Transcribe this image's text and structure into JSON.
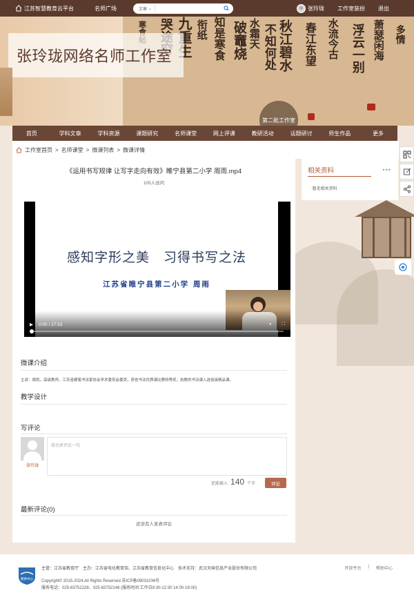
{
  "topbar": {
    "platform": "江苏智慧教育云平台",
    "teacher_square": "名师广场",
    "search_scope": "文章",
    "search_placeholder": "",
    "user_name": "张玲珑",
    "decorate": "工作室装扮",
    "logout": "退出"
  },
  "banner": {
    "title": "张玲珑网络名师工作室",
    "badge": "第二批工作室"
  },
  "nav": [
    "首页",
    "学科文章",
    "学科资源",
    "课题研究",
    "名师课堂",
    "网上评课",
    "教研活动",
    "话题研讨",
    "师生作品",
    "更多"
  ],
  "breadcrumb": [
    "工作室首页",
    "名师课堂",
    "微课列表",
    "微课详情"
  ],
  "breadcrumb_sep": ">",
  "video": {
    "title": "《运用书写规律 让写字走向有效》睢宁县第二小学 周雨.mp4",
    "visits": "105人访问",
    "slide_heading": "感知字形之美　习得书写之法",
    "slide_sub": "江苏省睢宁县第二小学 周雨",
    "time": "0:00 / 27:53",
    "progress": 0.0
  },
  "sections": {
    "intro_title": "微课介绍",
    "intro_text": "主讲：周雨，高级教师，江苏省硬笔书法家协会学术委员会委员，获省书法优质课比赛特等奖，执教的书法课入选省级精品课。",
    "design_title": "教学设计",
    "comment_title": "写评论",
    "comment_placeholder": "我也来评论一句",
    "commenter": "张玲珑",
    "can_input_label": "还能输入",
    "char_count": "140",
    "char_unit": "个字",
    "comment_button": "评论",
    "latest_title": "最新评论(0)",
    "no_comment": "还没有人发表评论"
  },
  "sidebar": {
    "title": "相关资料",
    "more": "•••",
    "empty": "暂无相关资料"
  },
  "footer": {
    "line1": "主管：江苏省教育厅　主办：江苏省电化教育馆、江苏省教育信息化中心　技术支持：武汉天喻信息产业股份有限公司",
    "line2": "Copyright© 2015-2024,All Rights Reserved 苏ICP备09031036号",
    "line3": "服务电话：025-83752228、025-83752146 (服务时间:工作日8:30-12:30 14:00-18:00)",
    "link_open": "开放平台",
    "link_sep": "|",
    "link_help": "帮助中心",
    "logo_text": "教育中心"
  },
  "colors": {
    "topbar": "#5a3a2c",
    "nav": "#6a4636",
    "accent": "#b45b36",
    "button": "#b66a4c",
    "page_bg": "#f1e7dc"
  }
}
